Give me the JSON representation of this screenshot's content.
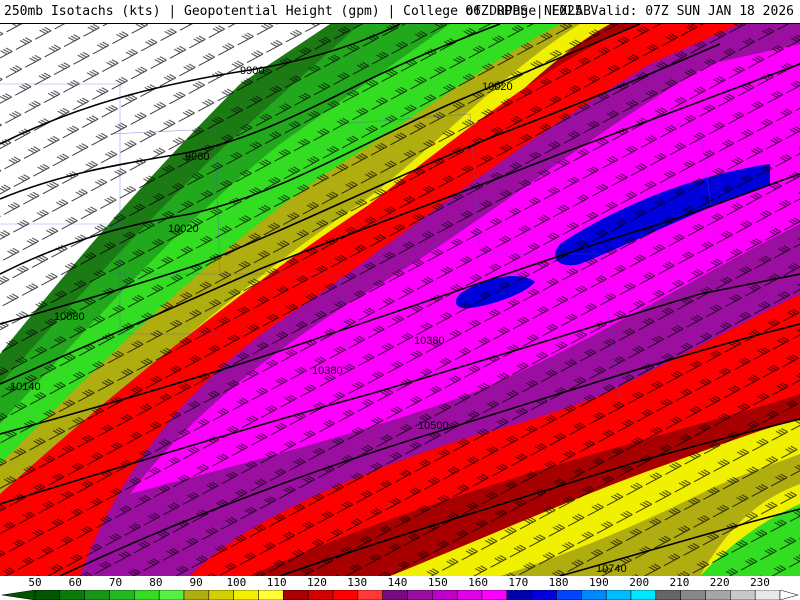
{
  "header": {
    "title_left": "250mb Isotachs (kts) | Geopotential Height (gpm) | College of DuPage NEXLAB",
    "title_right": "06Z RDPS | F025 Valid: 07Z SUN JAN 18 2026"
  },
  "map": {
    "contour_labels": [
      {
        "text": "9900"
      },
      {
        "text": "9960"
      },
      {
        "text": "10020"
      },
      {
        "text": "10080"
      },
      {
        "text": "10140"
      },
      {
        "text": "10020"
      },
      {
        "text": "10380"
      },
      {
        "text": "10380"
      },
      {
        "text": "10500"
      },
      {
        "text": "10740"
      }
    ],
    "bands": [
      {
        "speed": 50,
        "color": "#1c7a14"
      },
      {
        "speed": 60,
        "color": "#22a81c"
      },
      {
        "speed": 70,
        "color": "#33dd22"
      },
      {
        "speed": 90,
        "color": "#b0ad10"
      },
      {
        "speed": 100,
        "color": "#f0f000"
      },
      {
        "speed": 110,
        "color": "#a80000"
      },
      {
        "speed": 120,
        "color": "#ff0000"
      },
      {
        "speed": 140,
        "color": "#9a0ea0"
      },
      {
        "speed": 160,
        "color": "#ff00ff"
      },
      {
        "speed": 170,
        "color": "#0000dd"
      }
    ]
  },
  "colorbar": {
    "labels": [
      "50",
      "60",
      "70",
      "80",
      "90",
      "100",
      "110",
      "120",
      "130",
      "140",
      "150",
      "160",
      "170",
      "180",
      "190",
      "200",
      "210",
      "220",
      "230"
    ],
    "colors": [
      "#005500",
      "#0a7a0a",
      "#16961a",
      "#22b822",
      "#33dd22",
      "#55f044",
      "#b0ad10",
      "#d2cf00",
      "#f0f000",
      "#ffff33",
      "#a80000",
      "#d40000",
      "#ff0000",
      "#ff3838",
      "#7a0a80",
      "#9a0ea0",
      "#c000c8",
      "#e000e8",
      "#ff00ff",
      "#0000aa",
      "#0000dd",
      "#0044ff",
      "#0088ff",
      "#00bbff",
      "#00e8ff",
      "#666666",
      "#888888",
      "#a6a6a6",
      "#c8c8c8",
      "#e8e8e8"
    ]
  }
}
